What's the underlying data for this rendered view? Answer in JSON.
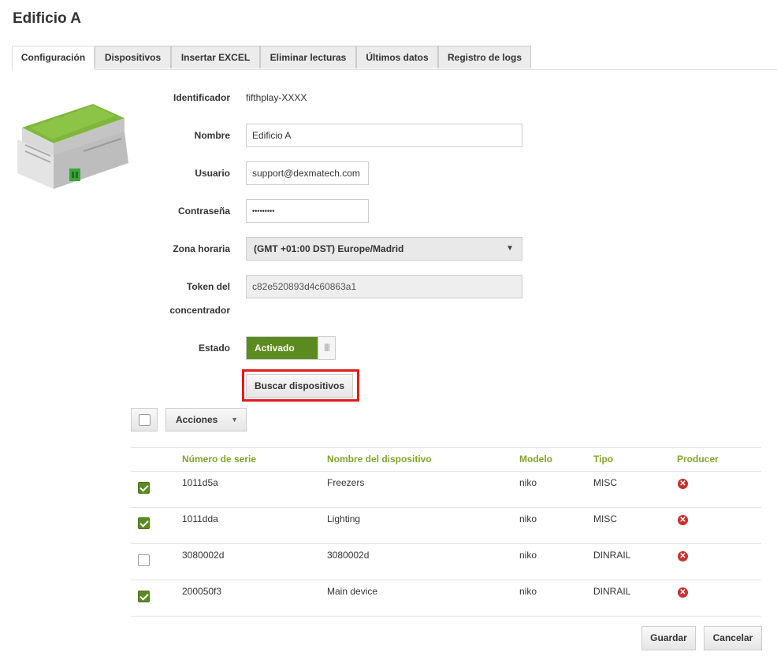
{
  "page_title": "Edificio A",
  "tabs": [
    {
      "label": "Configuración",
      "active": true
    },
    {
      "label": "Dispositivos",
      "active": false
    },
    {
      "label": "Insertar EXCEL",
      "active": false
    },
    {
      "label": "Eliminar lecturas",
      "active": false
    },
    {
      "label": "Últimos datos",
      "active": false
    },
    {
      "label": "Registro de logs",
      "active": false
    }
  ],
  "form": {
    "identificador_label": "Identificador",
    "identificador_value": "fifthplay-XXXX",
    "nombre_label": "Nombre",
    "nombre_value": "Edificio A",
    "usuario_label": "Usuario",
    "usuario_value": "support@dexmatech.com",
    "contrasena_label": "Contraseña",
    "contrasena_value": "•••••••••",
    "zona_label": "Zona horaria",
    "zona_value": "(GMT +01:00 DST) Europe/Madrid",
    "token_label_line1": "Token del",
    "token_label_line2": "concentrador",
    "token_value": "c82e520893d4c60863a1",
    "estado_label": "Estado",
    "estado_value": "Activado",
    "buscar_label": "Buscar dispositivos"
  },
  "actions": {
    "label": "Acciones"
  },
  "table": {
    "headers": [
      "Número de serie",
      "Nombre del dispositivo",
      "Modelo",
      "Tipo",
      "Producer"
    ],
    "rows": [
      {
        "checked": true,
        "serial": "1011d5a",
        "name": "Freezers",
        "model": "niko",
        "type": "MISC"
      },
      {
        "checked": true,
        "serial": "1011dda",
        "name": "Lighting",
        "model": "niko",
        "type": "MISC"
      },
      {
        "checked": false,
        "serial": "3080002d",
        "name": "3080002d",
        "model": "niko",
        "type": "DINRAIL"
      },
      {
        "checked": true,
        "serial": "200050f3",
        "name": "Main device",
        "model": "niko",
        "type": "DINRAIL"
      }
    ]
  },
  "footer": {
    "save_label": "Guardar",
    "cancel_label": "Cancelar"
  },
  "colors": {
    "accent_green": "#5b8a1e",
    "header_green": "#7ea52a",
    "highlight_red": "#e31b1b",
    "error_red": "#c9302c"
  }
}
